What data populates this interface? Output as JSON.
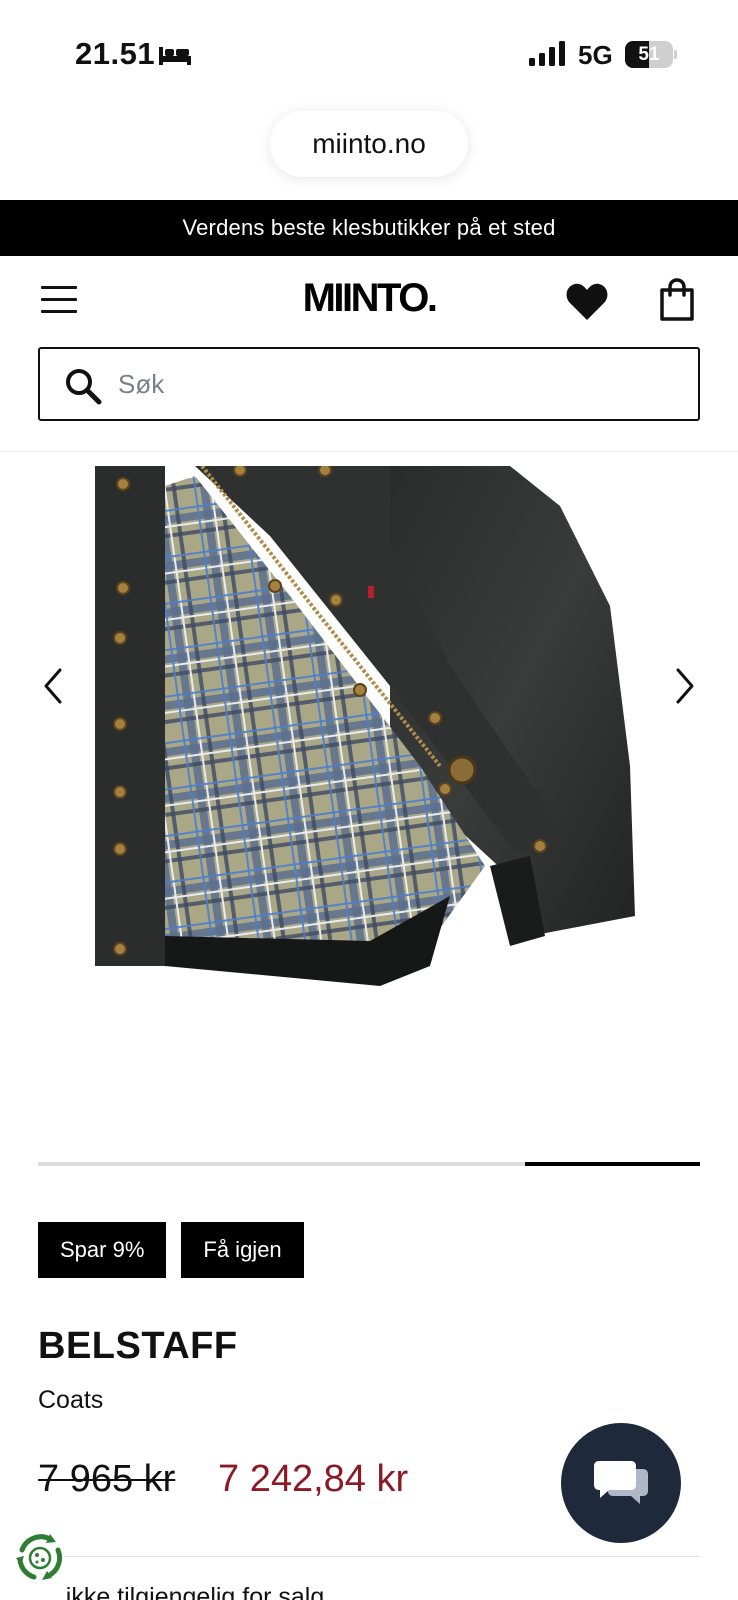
{
  "status_bar": {
    "time": "21.51",
    "network": "5G",
    "battery": "51",
    "battery_level": 0.51
  },
  "browser": {
    "url": "miinto.no"
  },
  "announcement": {
    "text": "Verdens beste klesbutikker på et sted"
  },
  "header": {
    "logo": "MIINTO."
  },
  "search": {
    "placeholder": "Søk",
    "value": ""
  },
  "gallery": {
    "progress_start": 0.735,
    "progress_end": 1.0
  },
  "badges": [
    "Spar 9%",
    "Få igjen"
  ],
  "product": {
    "brand": "BELSTAFF",
    "category": "Coats",
    "price_original": "7 965 kr",
    "price_sale": "7 242,84 kr"
  },
  "below_fold": {
    "text": "... ikke tilgjengelig for salg"
  },
  "colors": {
    "accent_black": "#000000",
    "sale_price": "#8b1a25",
    "chat_button": "#1e2a3b",
    "cookie_icon": "#2e7d32"
  },
  "icons": {
    "menu": "hamburger-icon",
    "favorites": "heart-icon",
    "cart": "shopping-bag-icon",
    "search": "search-icon",
    "prev": "chevron-left-icon",
    "next": "chevron-right-icon",
    "chat": "chat-bubbles-icon",
    "cookie": "cookie-settings-icon"
  }
}
